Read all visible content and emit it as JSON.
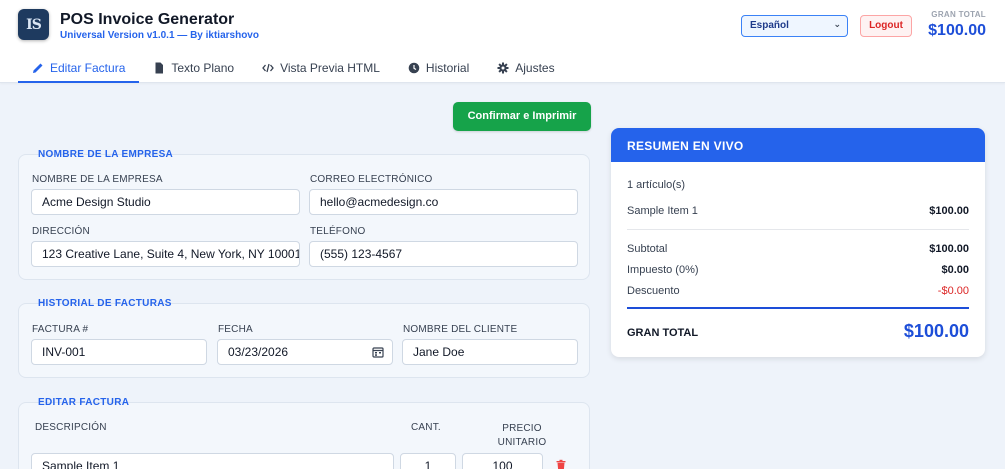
{
  "app": {
    "logo_text": "IS",
    "title": "POS Invoice Generator",
    "subtitle": "Universal Version v1.0.1 — By iktiarshovo",
    "language": "Español",
    "logout_label": "Logout",
    "grand_total_label": "GRAN TOTAL",
    "grand_total_value": "$100.00"
  },
  "tabs": [
    {
      "label": "Editar Factura",
      "icon": "pencil-icon",
      "active": true
    },
    {
      "label": "Texto Plano",
      "icon": "document-icon",
      "active": false
    },
    {
      "label": "Vista Previa HTML",
      "icon": "code-icon",
      "active": false
    },
    {
      "label": "Historial",
      "icon": "clock-icon",
      "active": false
    },
    {
      "label": "Ajustes",
      "icon": "gear-icon",
      "active": false
    }
  ],
  "actions": {
    "confirm_label": "Confirmar e Imprimir"
  },
  "company": {
    "section_title": "NOMBRE DE LA EMPRESA",
    "name_label": "NOMBRE DE LA EMPRESA",
    "name_value": "Acme Design Studio",
    "email_label": "CORREO ELECTRÓNICO",
    "email_value": "hello@acmedesign.co",
    "address_label": "DIRECCIÓN",
    "address_value": "123 Creative Lane, Suite 4, New York, NY 10001",
    "phone_label": "TELÉFONO",
    "phone_value": "(555) 123-4567"
  },
  "invoice_meta": {
    "section_title": "HISTORIAL DE FACTURAS",
    "invoice_label": "FACTURA #",
    "invoice_value": "INV-001",
    "date_label": "FECHA",
    "date_value": "03/23/2026",
    "client_label": "NOMBRE DEL CLIENTE",
    "client_value": "Jane Doe"
  },
  "items": {
    "section_title": "EDITAR FACTURA",
    "col_description": "DESCRIPCIÓN",
    "col_qty": "CANT.",
    "col_price": "PRECIO UNITARIO",
    "rows": [
      {
        "description": "Sample Item 1",
        "qty": "1",
        "price": "100"
      }
    ]
  },
  "summary": {
    "title": "RESUMEN EN VIVO",
    "item_count": "1 artículo(s)",
    "lines": [
      {
        "name": "Sample Item 1",
        "amount": "$100.00"
      }
    ],
    "subtotal_label": "Subtotal",
    "subtotal_value": "$100.00",
    "tax_label": "Impuesto (0%)",
    "tax_value": "$0.00",
    "discount_label": "Descuento",
    "discount_value": "-$0.00",
    "total_label": "GRAN TOTAL",
    "total_value": "$100.00"
  },
  "colors": {
    "accent": "#2563eb",
    "confirm": "#16a34a",
    "danger": "#dc2626"
  }
}
